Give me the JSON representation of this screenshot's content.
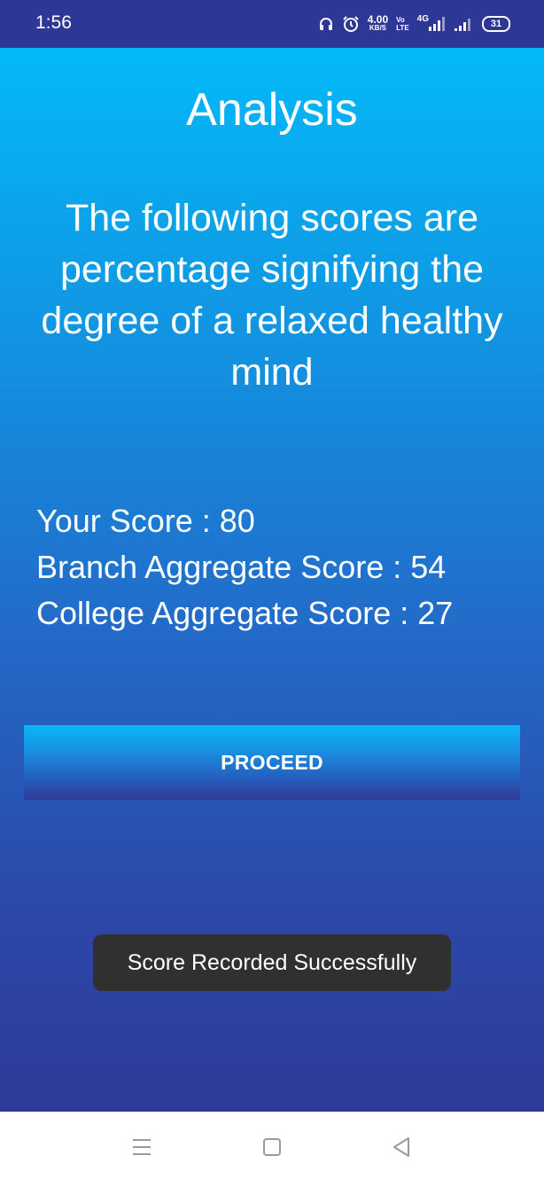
{
  "status_bar": {
    "time": "1:56",
    "speed_value": "4.00",
    "speed_unit": "KB/S",
    "volte_top": "Vo",
    "volte_bottom": "LTE",
    "network": "4G",
    "battery": "31"
  },
  "page": {
    "title": "Analysis",
    "description": "The following scores are percentage signifying the degree of a relaxed healthy mind"
  },
  "scores": {
    "your": "Your Score : 80",
    "branch": "Branch Aggregate Score : 54",
    "college": "College Aggregate Score : 27"
  },
  "proceed_label": "PROCEED",
  "toast": "Score Recorded Successfully",
  "nav": [
    "menu-icon",
    "home-icon",
    "back-icon"
  ],
  "colors": {
    "status_bar": "#2d3796",
    "gradient_top": "#03b9f7",
    "gradient_bottom": "#2f3a98",
    "toast_bg": "#303030"
  }
}
